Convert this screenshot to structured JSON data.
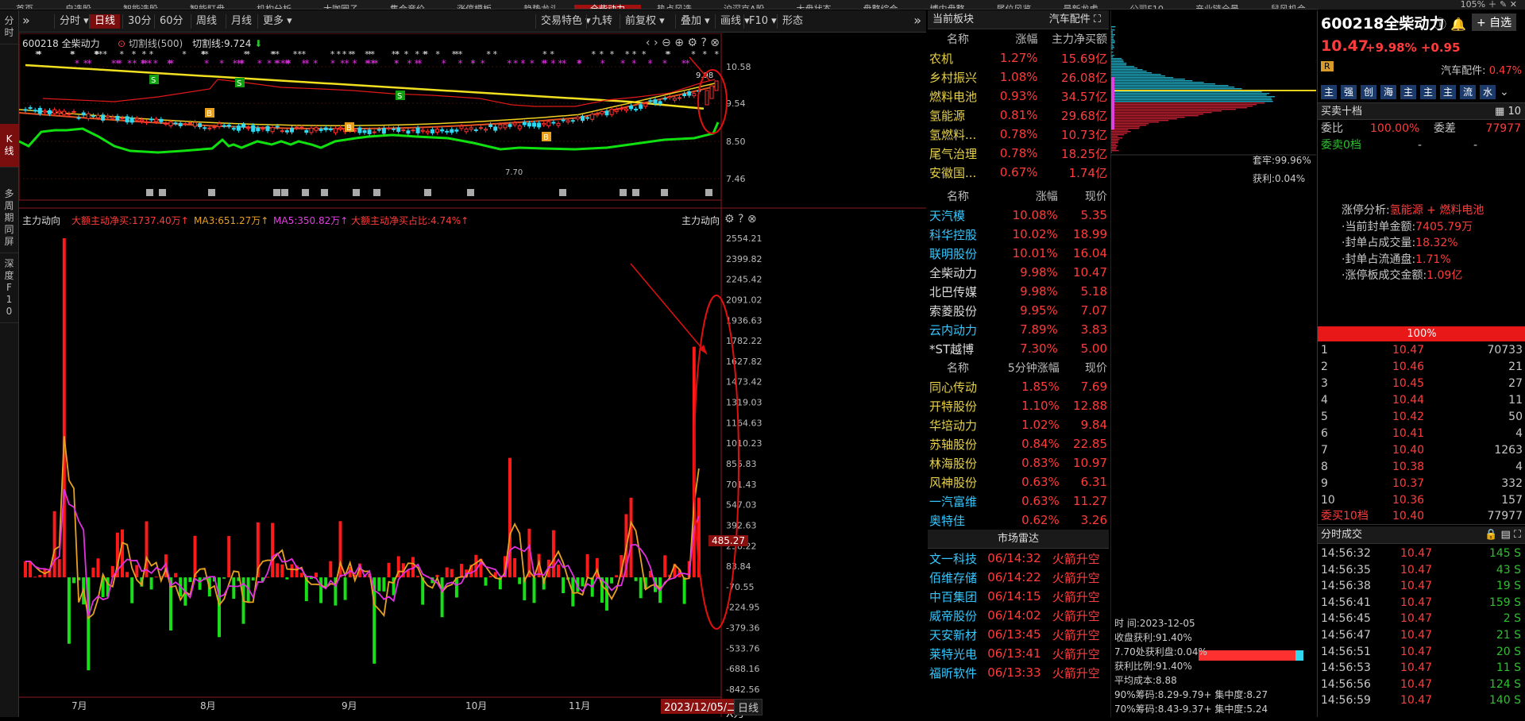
{
  "top_tabs": [
    "首页",
    "自选股",
    "智能选股",
    "智能盯盘",
    "机构分析",
    "大咖圈子",
    "集合竞价",
    "涨停模板",
    "趋势龙头",
    "全柴动力",
    "热点风选",
    "沪深京A股",
    "大盘状态",
    "盘整综合",
    "博内盘整",
    "尾位风览",
    "最新龙虎",
    "公司F10",
    "产业链全景",
    "鼠风机会"
  ],
  "zoom": "105%",
  "left_strip": [
    "分时",
    "K线",
    "多周期同屏",
    "深度F10"
  ],
  "toolbar_left": [
    "分时",
    "日线",
    "30分",
    "60分",
    "周线",
    "月线",
    "更多"
  ],
  "toolbar_right": [
    "交易特色",
    "九转",
    "前复权",
    "叠加",
    "画线",
    "F10",
    "形态"
  ],
  "chart_info": {
    "code_name": "600218 全柴动力",
    "cut_line": "切割线(500)",
    "cut_val": "切割线:9.724"
  },
  "price_axis": [
    "10.58",
    "9.54",
    "8.50",
    "7.46"
  ],
  "price_marks": {
    "high": "9.98",
    "low": "7.70"
  },
  "sub_title": "主力动向",
  "indicator": {
    "net": "大额主动净买:1737.40万",
    "ma3": "MA3:651.27万",
    "ma5": "MA5:350.82万",
    "ratio": "大额主动净买占比:4.74%"
  },
  "sub_axis": [
    "2554.21",
    "2399.82",
    "2245.42",
    "2091.02",
    "1936.63",
    "1782.22",
    "1627.82",
    "1473.42",
    "1319.03",
    "1164.63",
    "1010.23",
    "855.83",
    "701.43",
    "547.03",
    "392.63",
    "238.22",
    "83.84",
    "-70.55",
    "-224.95",
    "-379.36",
    "-533.76",
    "-688.16",
    "-842.56"
  ],
  "current_marker": "485.27",
  "axis_unit": "X万",
  "months": [
    "7月",
    "8月",
    "9月",
    "10月",
    "11月"
  ],
  "current_date": "2023/12/05/二",
  "period_label": "日线",
  "sector": {
    "header": "当前板块",
    "sub": "汽车配件",
    "cols": [
      "名称",
      "涨幅",
      "主力净买额"
    ],
    "rows": [
      [
        "农机",
        "1.27%",
        "15.69亿"
      ],
      [
        "乡村振兴",
        "1.08%",
        "26.08亿"
      ],
      [
        "燃料电池",
        "0.93%",
        "34.57亿"
      ],
      [
        "氢能源",
        "0.81%",
        "29.68亿"
      ],
      [
        "氢燃料...",
        "0.78%",
        "10.73亿"
      ],
      [
        "尾气治理",
        "0.78%",
        "18.25亿"
      ],
      [
        "安徽国...",
        "0.67%",
        "1.74亿"
      ]
    ]
  },
  "stocks": {
    "cols": [
      "名称",
      "涨幅",
      "现价"
    ],
    "rows": [
      [
        "天汽模",
        "10.08%",
        "5.35",
        "c"
      ],
      [
        "科华控股",
        "10.02%",
        "18.99",
        "c"
      ],
      [
        "联明股份",
        "10.01%",
        "16.04",
        "c"
      ],
      [
        "全柴动力",
        "9.98%",
        "10.47",
        "w"
      ],
      [
        "北巴传媒",
        "9.98%",
        "5.18",
        "w"
      ],
      [
        "索菱股份",
        "9.95%",
        "7.07",
        "w"
      ],
      [
        "云内动力",
        "7.89%",
        "3.83",
        "c"
      ],
      [
        "*ST越博",
        "7.30%",
        "5.00",
        "w"
      ]
    ]
  },
  "five_min": {
    "cols": [
      "名称",
      "5分钟涨幅",
      "现价"
    ],
    "rows": [
      [
        "同心传动",
        "1.85%",
        "7.69"
      ],
      [
        "开特股份",
        "1.10%",
        "12.88"
      ],
      [
        "华培动力",
        "1.02%",
        "9.84"
      ],
      [
        "苏轴股份",
        "0.84%",
        "22.85"
      ],
      [
        "林海股份",
        "0.83%",
        "10.97"
      ],
      [
        "风神股份",
        "0.63%",
        "6.31"
      ],
      [
        "一汽富维",
        "0.63%",
        "11.27"
      ],
      [
        "奥特佳",
        "0.62%",
        "3.26"
      ]
    ]
  },
  "radar": {
    "header": "市场雷达",
    "rows": [
      [
        "文一科技",
        "06/14:32",
        "火箭升空"
      ],
      [
        "佰维存储",
        "06/14:22",
        "火箭升空"
      ],
      [
        "中百集团",
        "06/14:15",
        "火箭升空"
      ],
      [
        "威帝股份",
        "06/14:02",
        "火箭升空"
      ],
      [
        "天安新材",
        "06/13:45",
        "火箭升空"
      ],
      [
        "莱特光电",
        "06/13:41",
        "火箭升空"
      ],
      [
        "福昕软件",
        "06/13:33",
        "火箭升空"
      ]
    ]
  },
  "chip": {
    "profit_top": "套牢:99.96%",
    "profit_mid": "获利:0.04%",
    "date": "时    间:2023-12-05",
    "profit": "收盘获利:91.40%",
    "at_price": "7.70处获利盘:0.04%",
    "ratio": "获利比例:91.40%",
    "avg": "平均成本:8.88",
    "r90": "90%筹码:8.29-9.79+ 集中度:8.27",
    "r70": "70%筹码:8.43-9.37+ 集中度:5.24"
  },
  "quote": {
    "code": "600218",
    "name": "全柴动力",
    "price": "10.47",
    "pct": "+9.98%",
    "chg": "+0.95",
    "add": "+ 自选",
    "industry": "汽车配件:",
    "ind_pct": "0.47%",
    "tags": [
      "主",
      "强",
      "创",
      "海",
      "主",
      "主",
      "主",
      "流",
      "水"
    ],
    "bid_header": "买卖十档",
    "wb_label": "委比",
    "wb": "100.00%",
    "wc_label": "委差",
    "wc": "77977",
    "sell0": "委卖0档",
    "sell0_a": "-",
    "sell0_b": "-",
    "limit_title": "涨停分析:",
    "limit_val": "氢能源 + 燃料电池",
    "seal_amt_l": "·当前封单金额:",
    "seal_amt": "7405.79万",
    "seal_vol_l": "·封单占成交量:",
    "seal_vol": "18.32%",
    "seal_flt_l": "·封单占流通盘:",
    "seal_flt": "1.71%",
    "deal_l": "·涨停板成交金额:",
    "deal": "1.09亿",
    "pct100": "100%",
    "bids": [
      [
        "1",
        "10.47",
        "70733"
      ],
      [
        "2",
        "10.46",
        "21"
      ],
      [
        "3",
        "10.45",
        "27"
      ],
      [
        "4",
        "10.44",
        "11"
      ],
      [
        "5",
        "10.42",
        "50"
      ],
      [
        "6",
        "10.41",
        "4"
      ],
      [
        "7",
        "10.40",
        "1263"
      ],
      [
        "8",
        "10.38",
        "4"
      ],
      [
        "9",
        "10.37",
        "332"
      ],
      [
        "10",
        "10.36",
        "157"
      ]
    ],
    "buy10": [
      "委买10档",
      "10.40",
      "77977"
    ]
  },
  "ticks_header": "分时成交",
  "ticks": [
    [
      "14:56:32",
      "10.47",
      "145 S"
    ],
    [
      "14:56:35",
      "10.47",
      "43 S"
    ],
    [
      "14:56:38",
      "10.47",
      "19 S"
    ],
    [
      "14:56:41",
      "10.47",
      "159 S"
    ],
    [
      "14:56:45",
      "10.47",
      "2 S"
    ],
    [
      "14:56:47",
      "10.47",
      "21 S"
    ],
    [
      "14:56:51",
      "10.47",
      "20 S"
    ],
    [
      "14:56:53",
      "10.47",
      "11 S"
    ],
    [
      "14:56:56",
      "10.47",
      "124 S"
    ],
    [
      "14:56:59",
      "10.47",
      "140 S"
    ]
  ]
}
